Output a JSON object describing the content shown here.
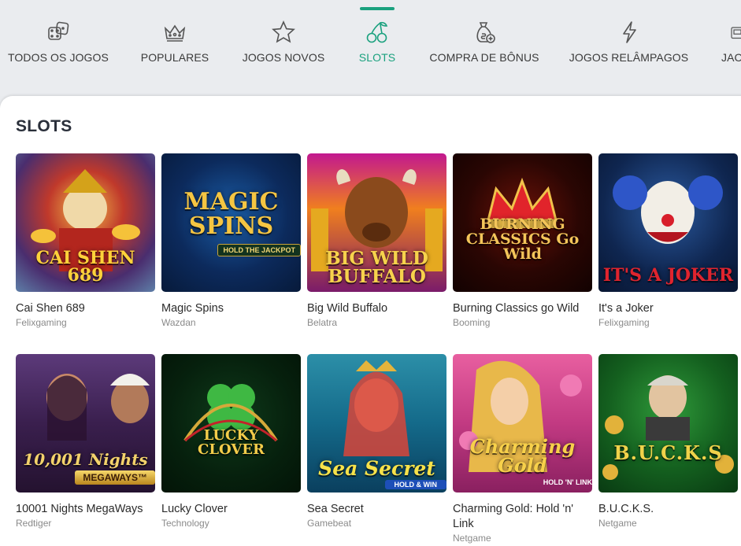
{
  "nav": {
    "items": [
      {
        "label": "TODOS OS JOGOS",
        "icon": "dice-icon"
      },
      {
        "label": "POPULARES",
        "icon": "crown-icon"
      },
      {
        "label": "JOGOS NOVOS",
        "icon": "star-icon"
      },
      {
        "label": "SLOTS",
        "icon": "cherries-icon",
        "active": true
      },
      {
        "label": "COMPRA DE BÔNUS",
        "icon": "money-bag-icon"
      },
      {
        "label": "JOGOS RELÂMPAGOS",
        "icon": "lightning-icon"
      },
      {
        "label": "JAC",
        "icon": "jackpot-icon"
      }
    ],
    "accent_color": "#1aa17e"
  },
  "section": {
    "title": "SLOTS"
  },
  "games": [
    {
      "name": "Cai Shen 689",
      "provider": "Felixgaming",
      "logo": "CAI SHEN 689"
    },
    {
      "name": "Magic Spins",
      "provider": "Wazdan",
      "logo": "MAGIC SPINS",
      "logo_sub": "HOLD THE JACKPOT"
    },
    {
      "name": "Big Wild Buffalo",
      "provider": "Belatra",
      "logo": "BIG WILD BUFFALO"
    },
    {
      "name": "Burning Classics go Wild",
      "provider": "Booming",
      "logo": "BURNING CLASSICS Go Wild"
    },
    {
      "name": "It's a Joker",
      "provider": "Felixgaming",
      "logo": "IT'S A JOKER"
    },
    {
      "name": "10001 Nights MegaWays",
      "provider": "Redtiger",
      "logo": "10,001 Nights",
      "logo_sub": "MEGAWAYS™"
    },
    {
      "name": "Lucky Clover",
      "provider": "Technology",
      "logo": "LUCKY CLOVER"
    },
    {
      "name": "Sea Secret",
      "provider": "Gamebeat",
      "logo": "Sea Secret",
      "logo_sub": "HOLD & WIN"
    },
    {
      "name": "Charming Gold: Hold 'n' Link",
      "provider": "Netgame",
      "logo": "Charming Gold",
      "logo_sub": "HOLD 'N' LINK"
    },
    {
      "name": "B.U.C.K.S.",
      "provider": "Netgame",
      "logo": "B.U.C.K.S"
    }
  ]
}
